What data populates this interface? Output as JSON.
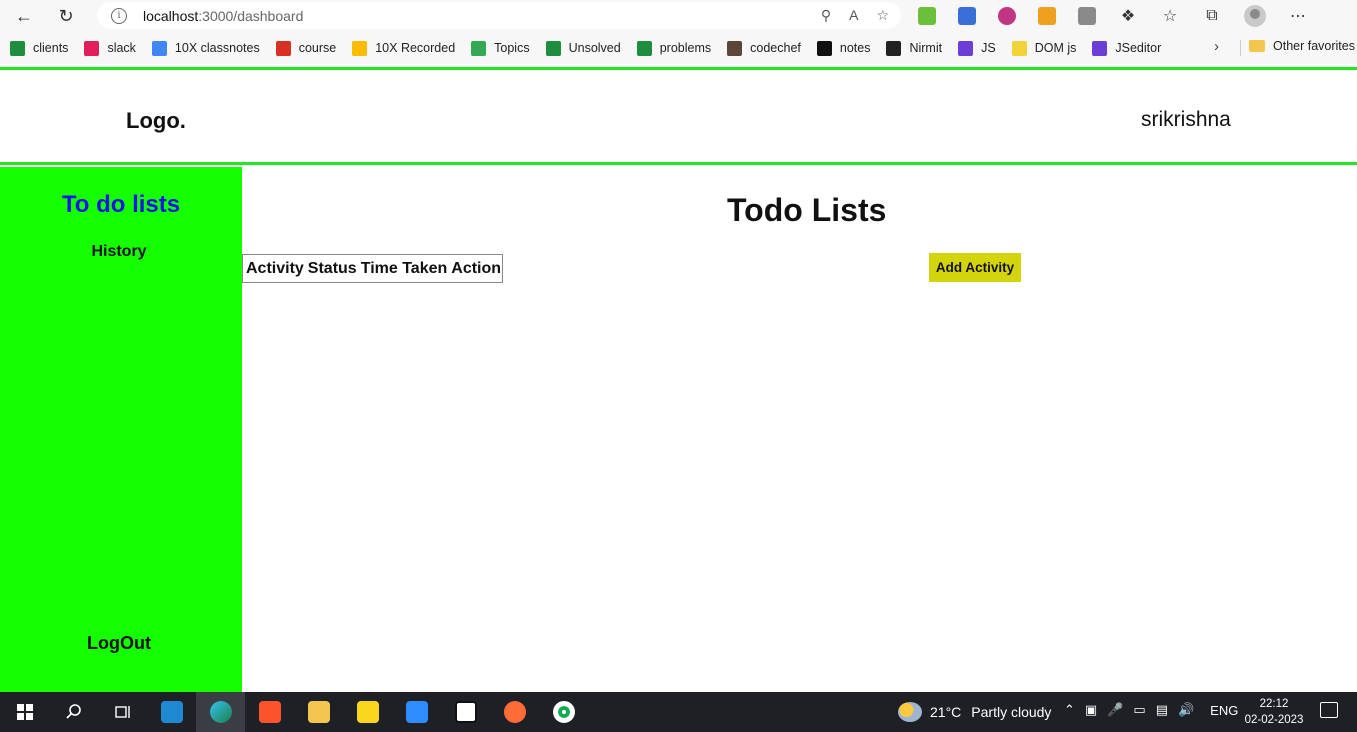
{
  "browser": {
    "url_host": "localhost",
    "url_rest": ":3000/dashboard",
    "bookmarks": [
      {
        "label": "clients",
        "icon": "sheets-icon",
        "color": "#1e8e3e"
      },
      {
        "label": "slack",
        "icon": "slack-icon",
        "color": "#e01e5a"
      },
      {
        "label": "10X classnotes",
        "icon": "docs-icon",
        "color": "#4285f4"
      },
      {
        "label": "course",
        "icon": "10x-icon",
        "color": "#d93025"
      },
      {
        "label": "10X Recorded",
        "icon": "drive-icon",
        "color": "#fbbc04"
      },
      {
        "label": "Topics",
        "icon": "drive-icon",
        "color": "#34a853"
      },
      {
        "label": "Unsolved",
        "icon": "sheets-icon",
        "color": "#1e8e3e"
      },
      {
        "label": "problems",
        "icon": "sheets-icon",
        "color": "#1e8e3e"
      },
      {
        "label": "codechef",
        "icon": "codechef-icon",
        "color": "#5b4638"
      },
      {
        "label": "notes",
        "icon": "notion-icon",
        "color": "#111111"
      },
      {
        "label": "Nirmit",
        "icon": "github-icon",
        "color": "#222222"
      },
      {
        "label": "JS",
        "icon": "replit-icon",
        "color": "#6b3fd6"
      },
      {
        "label": "DOM js",
        "icon": "js-icon",
        "color": "#f0d43a"
      },
      {
        "label": "JSeditor",
        "icon": "replit-icon",
        "color": "#6b3fd6"
      }
    ],
    "other_favorites": "Other favorites"
  },
  "header": {
    "logo": "Logo.",
    "username": "srikrishna"
  },
  "sidebar": {
    "title": "To do lists",
    "history": "History",
    "logout": "LogOut"
  },
  "main": {
    "title": "Todo Lists",
    "columns": [
      "Activity",
      "Status",
      "Time Taken",
      "Action"
    ],
    "add_button": "Add Activity"
  },
  "taskbar": {
    "weather_temp": "21°C",
    "weather_text": "Partly cloudy",
    "language": "ENG",
    "time": "22:12",
    "date": "02-02-2023"
  },
  "colors": {
    "accent_green": "#16ff00",
    "sidebar_title": "#1414e6",
    "add_button": "#d4d40c"
  }
}
